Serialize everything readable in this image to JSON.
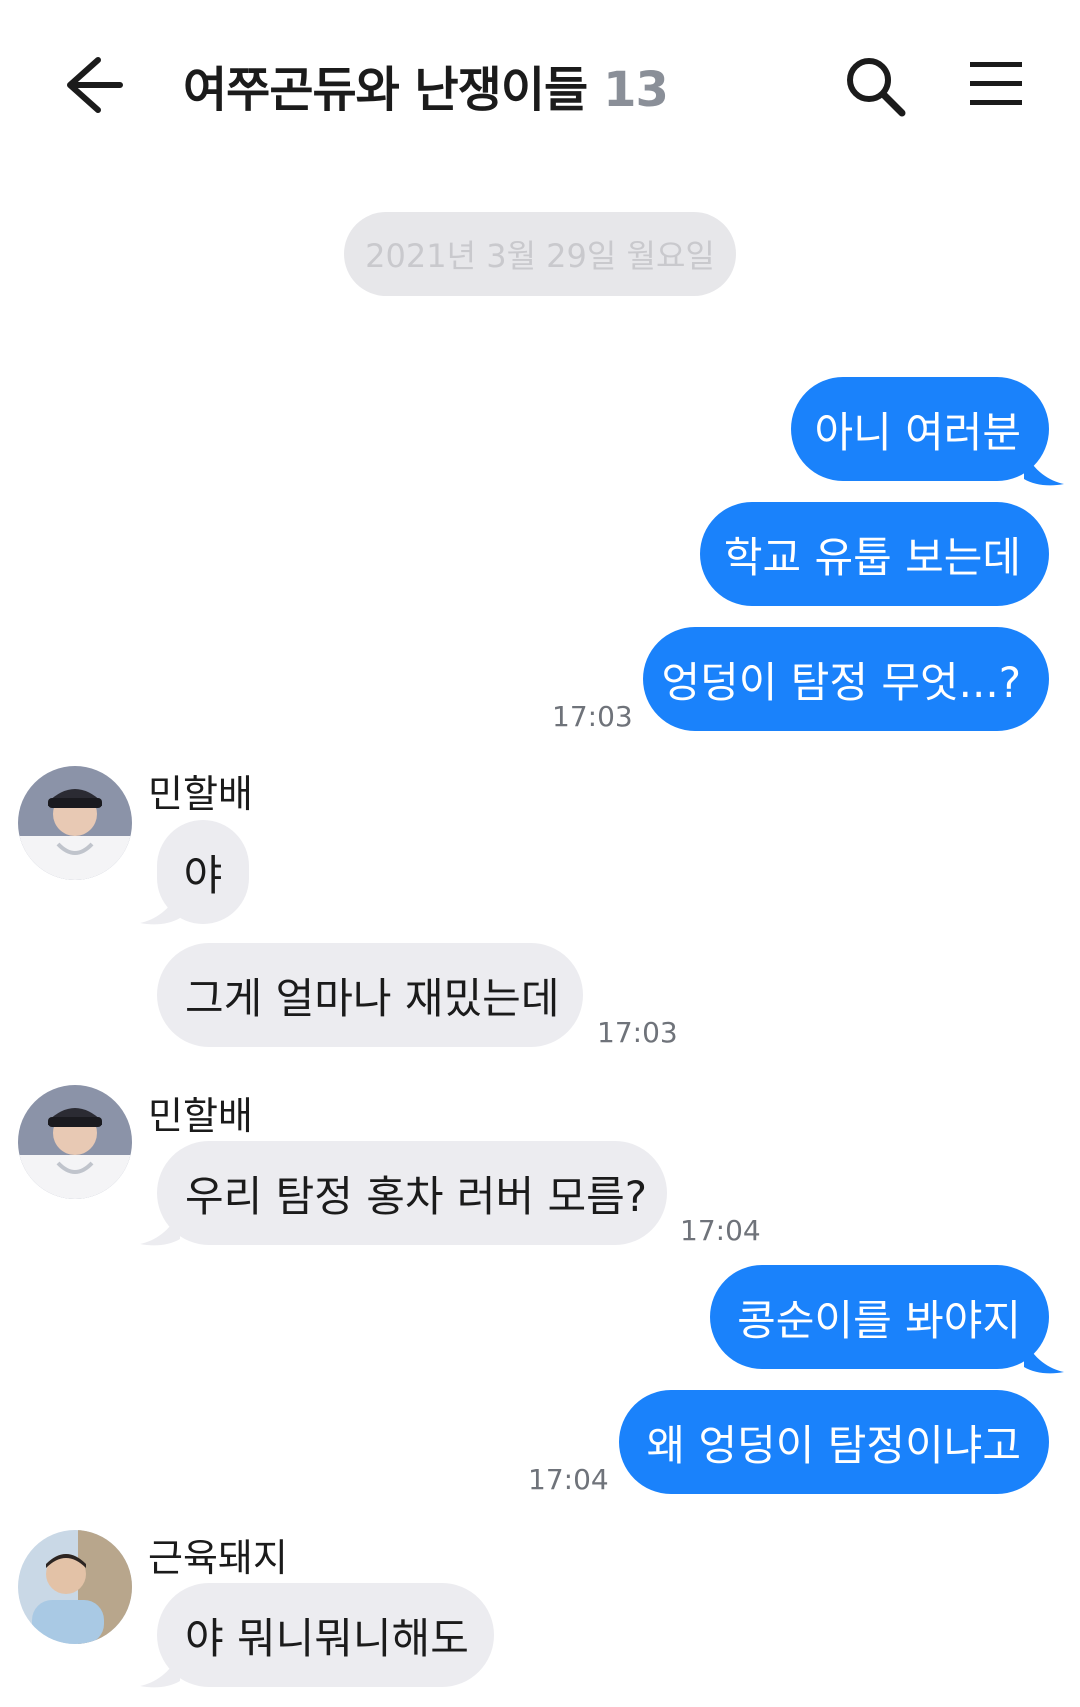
{
  "header": {
    "title": "여쭈곤듀와 난쟁이들",
    "member_count": "13",
    "back_icon": "arrow-left-icon",
    "search_icon": "search-icon",
    "menu_icon": "hamburger-menu-icon"
  },
  "date_divider": "2021년 3월 29일 월요일",
  "colors": {
    "outgoing": "#1a82fb",
    "incoming": "#ececf0",
    "accent_text": "#8a8f98"
  },
  "messages": {
    "m1": "아니 여러분",
    "m2": "학교 유툽 보는데",
    "m3": "엉덩이 탐정 무엇...?",
    "t1": "17:03",
    "sender1": "민할배",
    "m4": "야",
    "m5": "그게 얼마나 재밌는데",
    "t2": "17:03",
    "sender2": "민할배",
    "m6": "우리 탐정 홍차 러버 모름?",
    "t3": "17:04",
    "m7": "콩순이를 봐야지",
    "m8": "왜 엉덩이 탐정이냐고",
    "t4": "17:04",
    "sender3": "근육돼지",
    "m9": "야 뭐니뭐니해도"
  }
}
